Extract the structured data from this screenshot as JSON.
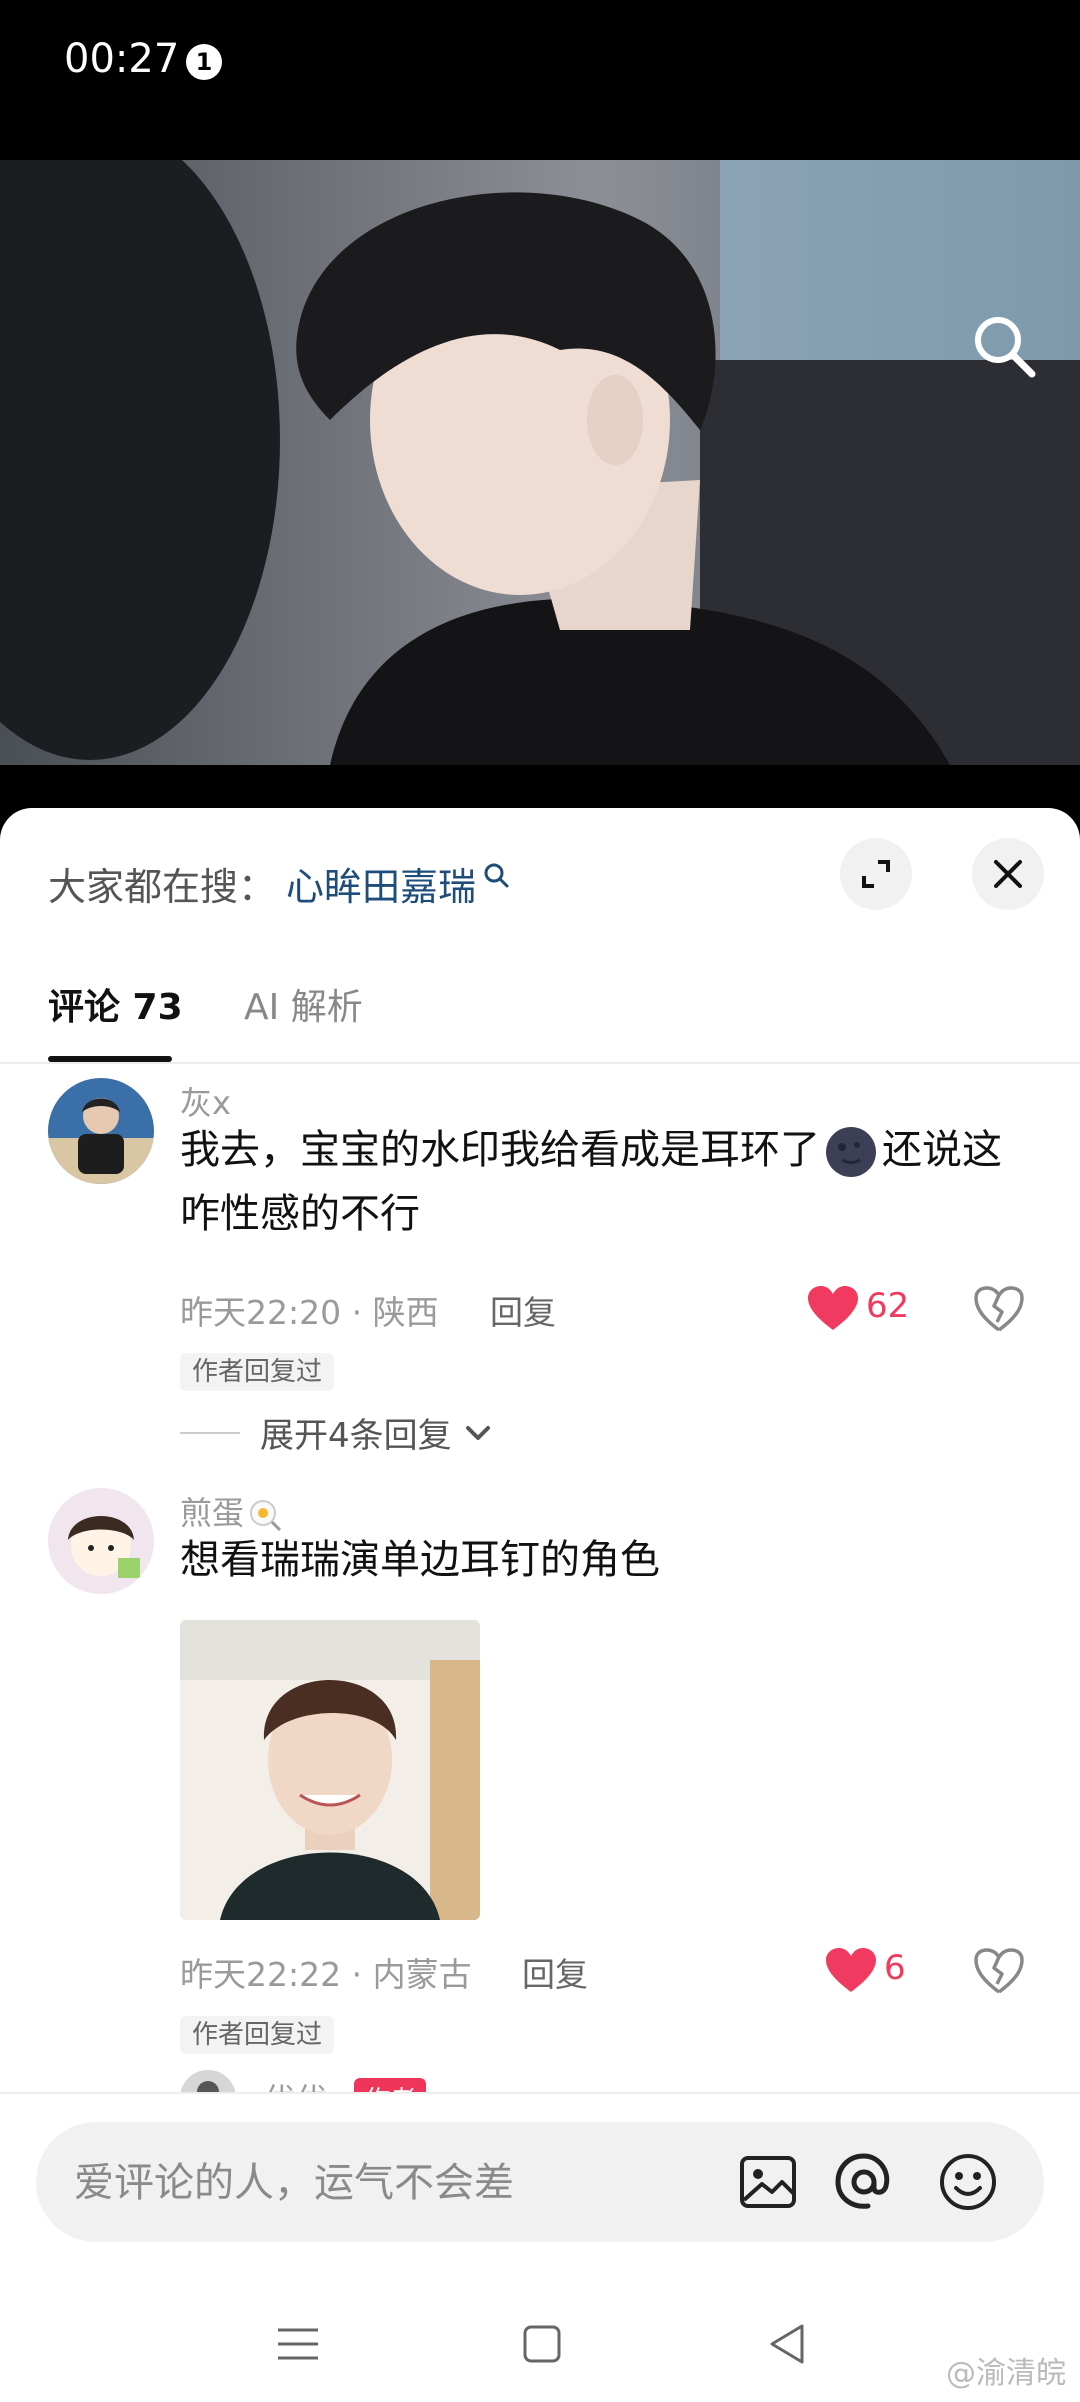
{
  "status_bar": {
    "time": "00:27",
    "notification_count": "1"
  },
  "search_hint": {
    "label": "大家都在搜：",
    "query": "心眸田嘉瑞"
  },
  "tabs": [
    {
      "label": "评论 73"
    },
    {
      "label": "AI 解析"
    }
  ],
  "comments": [
    {
      "username": "灰x",
      "text_part1": "我去，宝宝的水印我给看成是耳环了",
      "text_part2": "还说这咋性感的不行",
      "time": "昨天22:20",
      "location": "陕西",
      "reply_label": "回复",
      "likes": "62",
      "author_badge": "作者回复过",
      "expand_replies": "展开4条回复"
    },
    {
      "username": "煎蛋",
      "text": "想看瑞瑞演单边耳钉的角色",
      "time": "昨天22:22",
      "location": "内蒙古",
      "reply_label": "回复",
      "likes": "6",
      "author_badge": "作者回复过",
      "reply_preview": {
        "username": "优优.",
        "badge": "作者"
      }
    }
  ],
  "meta_separator": " · ",
  "input": {
    "placeholder": "爱评论的人，运气不会差"
  },
  "watermark": "@渝清皖",
  "colors": {
    "like": "#f03a5f",
    "search_query": "#1f4d7a",
    "author_tag": "#f0355a"
  }
}
